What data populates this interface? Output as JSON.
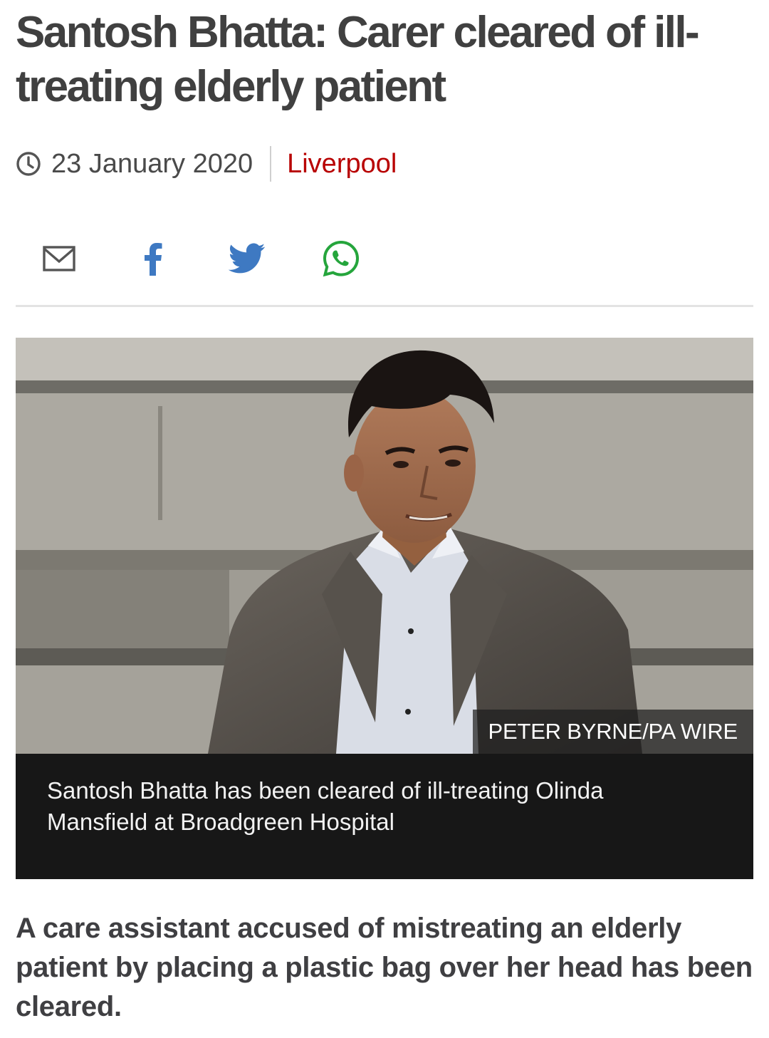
{
  "article": {
    "headline": "Santosh Bhatta: Carer cleared of ill-treating elderly patient",
    "date": "23 January 2020",
    "location": "Liverpool",
    "lead": "A care assistant accused of mistreating an elderly patient by placing a plastic bag over her head has been cleared."
  },
  "share": {
    "icons": [
      "email-icon",
      "facebook-icon",
      "twitter-icon",
      "whatsapp-icon"
    ]
  },
  "image": {
    "credit": "PETER BYRNE/PA WIRE",
    "caption": "Santosh Bhatta has been cleared of ill-treating Olinda Mansfield at Broadgreen Hospital"
  },
  "colors": {
    "headline": "#404040",
    "location_link": "#b80000",
    "share_icons": "#3e79c2",
    "whatsapp": "#25a53c",
    "caption_background": "#171717"
  }
}
